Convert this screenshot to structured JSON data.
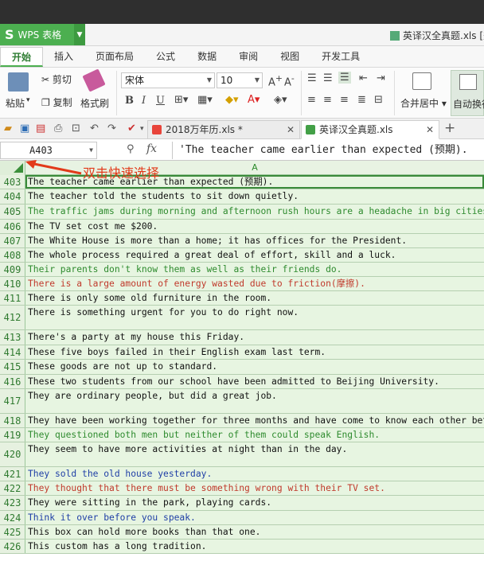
{
  "app": {
    "name": "WPS 表格",
    "logo_glyph": "S",
    "window_doc_title": "英译汉全真题.xls [兼"
  },
  "ribbon_tabs": [
    "开始",
    "插入",
    "页面布局",
    "公式",
    "数据",
    "审阅",
    "视图",
    "开发工具"
  ],
  "ribbon": {
    "paste_label": "粘贴",
    "cut_label": "剪切",
    "copy_label": "复制",
    "format_painter_label": "格式刷",
    "font_name": "宋体",
    "font_size": "10",
    "bold": "B",
    "italic": "I",
    "underline": "U",
    "merge_label": "合并居中",
    "autowrap_label": "自动换行"
  },
  "doc_tabs": [
    {
      "label": "2018万年历.xls *",
      "active": false,
      "color": "#e8443a"
    },
    {
      "label": "英译汉全真题.xls",
      "active": true,
      "color": "#43a047"
    }
  ],
  "formula_bar": {
    "cell_ref": "A403",
    "fx": "fx",
    "content": "'The teacher came earlier than expected (预期)."
  },
  "column_header": "A",
  "annotation": "双击快速选择",
  "colors": {
    "accent": "#4caf50",
    "cell_bg": "#e7f5e1",
    "text_black": "#111111",
    "text_green": "#2e8b2e",
    "text_red": "#c0392b",
    "text_blue": "#1f3fa6",
    "annotation_red": "#e23a1a"
  },
  "rows": [
    {
      "num": "403",
      "text": "The teacher came earlier than expected (预期).",
      "color": "black",
      "h": 18,
      "selected": true
    },
    {
      "num": "404",
      "text": "The teacher told the students to sit down quietly.",
      "color": "black",
      "h": 19
    },
    {
      "num": "405",
      "text": "The traffic jams during morning and afternoon rush hours are a headache in big cities.",
      "color": "green",
      "h": 19
    },
    {
      "num": "406",
      "text": "The TV set cost me $200.",
      "color": "black",
      "h": 18
    },
    {
      "num": "407",
      "text": "The White House is more than a home; it has offices for the President.",
      "color": "black",
      "h": 18
    },
    {
      "num": "408",
      "text": "The whole process required a great deal of effort, skill and a luck.",
      "color": "black",
      "h": 18
    },
    {
      "num": "409",
      "text": "Their parents don't know them as well as their friends do.",
      "color": "green",
      "h": 18
    },
    {
      "num": "410",
      "text": "There is a large amount of energy wasted due to friction(摩擦).",
      "color": "red",
      "h": 18
    },
    {
      "num": "411",
      "text": "There is only some old furniture in the room.",
      "color": "black",
      "h": 18
    },
    {
      "num": "412",
      "text": "There is something urgent for you to do right now.",
      "color": "black",
      "h": 31
    },
    {
      "num": "413",
      "text": "There's a party at my house this Friday.",
      "color": "black",
      "h": 19
    },
    {
      "num": "414",
      "text": "These five boys failed in their English exam last term.",
      "color": "black",
      "h": 18
    },
    {
      "num": "415",
      "text": "These goods are not up to standard.",
      "color": "black",
      "h": 19
    },
    {
      "num": "416",
      "text": "These two students from our school have been admitted to Beijing University.",
      "color": "black",
      "h": 18
    },
    {
      "num": "417",
      "text": "They are ordinary people, but did a great job.",
      "color": "black",
      "h": 31
    },
    {
      "num": "418",
      "text": "They have been working together for three months and have come to know each other better.",
      "color": "black",
      "h": 18
    },
    {
      "num": "419",
      "text": "They questioned both men but neither of them could speak English.",
      "color": "green",
      "h": 18
    },
    {
      "num": "420",
      "text": "They seem to have more activities at night than in the day.",
      "color": "black",
      "h": 31
    },
    {
      "num": "421",
      "text": "They sold the old house yesterday.",
      "color": "blue",
      "h": 18
    },
    {
      "num": "422",
      "text": "They thought that there must be something wrong with their TV set.",
      "color": "red",
      "h": 18
    },
    {
      "num": "423",
      "text": "They were sitting in the park, playing cards.",
      "color": "black",
      "h": 19
    },
    {
      "num": "424",
      "text": "Think it over before you speak.",
      "color": "blue",
      "h": 18
    },
    {
      "num": "425",
      "text": "This box can hold more books than that one.",
      "color": "black",
      "h": 18
    },
    {
      "num": "426",
      "text": "This custom has a long tradition.",
      "color": "black",
      "h": 18
    }
  ]
}
